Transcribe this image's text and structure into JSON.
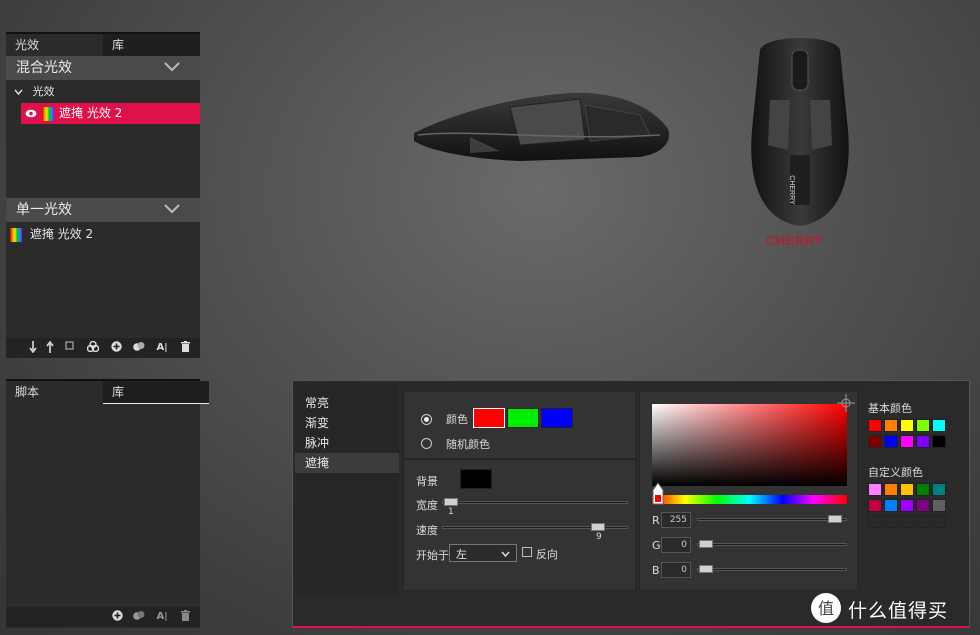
{
  "left_panel_top": {
    "tabs": [
      "光效",
      "库"
    ],
    "group1": "混合光效",
    "tree_parent": "光效",
    "selected_item": "遮掩 光效 2",
    "group2": "单一光效",
    "single_item": "遮掩 光效 2",
    "toolbar_icons": [
      "move-down-icon",
      "move-up-icon",
      "duplicate-icon",
      "group-icon",
      "add-icon",
      "merge-icon",
      "rename-icon",
      "delete-icon"
    ]
  },
  "left_panel_bottom": {
    "tabs": [
      "脚本",
      "库"
    ],
    "toolbar_icons": [
      "add-icon",
      "merge-icon",
      "rename-icon",
      "delete-icon"
    ]
  },
  "brand": "CHERRY",
  "effect_dialog": {
    "categories": [
      "常亮",
      "渐变",
      "脉冲",
      "遮掩"
    ],
    "active_category": "遮掩",
    "color_option": "颜色",
    "random_option": "随机颜色",
    "color_swatches": [
      "#ff0000",
      "#00ee00",
      "#0000ff"
    ],
    "background_label": "背景",
    "background_color": "#000000",
    "width_label": "宽度",
    "width_value": "1",
    "speed_label": "速度",
    "speed_value": "9",
    "start_label": "开始于",
    "start_value": "左",
    "reverse_label": "反向"
  },
  "color_picker": {
    "r_label": "R",
    "r_value": "255",
    "g_label": "G",
    "g_value": "0",
    "b_label": "B",
    "b_value": "0",
    "basic_title": "基本颜色",
    "basic_colors": [
      "#ff0000",
      "#ff8000",
      "#ffff00",
      "#80ff00",
      "#00ffff",
      "#800000",
      "#0000ff",
      "#ff00ff",
      "#8000ff",
      "#000000"
    ],
    "custom_title": "自定义颜色",
    "custom_colors": [
      "#ff80ff",
      "#ff8000",
      "#ffc000",
      "#008000",
      "#008080",
      "#c00040",
      "#0080ff",
      "#a000ff",
      "#800080",
      "#606060",
      "#2a2a2a",
      "#2a2a2a",
      "#2a2a2a",
      "#2a2a2a",
      "#2a2a2a"
    ]
  },
  "watermark": "什么值得买"
}
